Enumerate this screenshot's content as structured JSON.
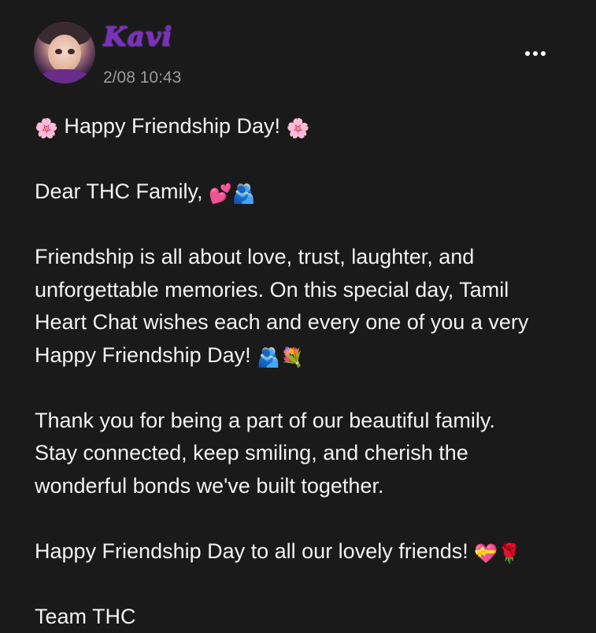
{
  "post": {
    "username": "Kavi",
    "timestamp": "2/08 10:43",
    "more_icon": "more-horizontal-icon",
    "title": "Happy Friendship Day!",
    "title_emoji_left": "🌸",
    "title_emoji_right": "🌸",
    "greeting": "Dear THC Family,",
    "greeting_emojis": "💕🫂",
    "para1_line1": "Friendship is all about love, trust, laughter, and",
    "para1_line2": "unforgettable memories. On this special day, Tamil",
    "para1_line3": "Heart Chat wishes each and every one of you a very",
    "para1_line4": "Happy Friendship Day!",
    "para1_emojis": "🫂💐",
    "para2_line1": "Thank you for being a part of our beautiful family.",
    "para2_line2": "Stay connected, keep smiling, and cherish the",
    "para2_line3": "wonderful bonds we've built together.",
    "closing": "Happy Friendship Day to all our lovely friends!",
    "closing_emojis": "💝🌹",
    "signature": "Team THC"
  },
  "colors": {
    "background": "#1a1a1a",
    "username": "#7b2fbf",
    "text": "#f2f2f2",
    "timestamp": "#9a9a9a"
  }
}
